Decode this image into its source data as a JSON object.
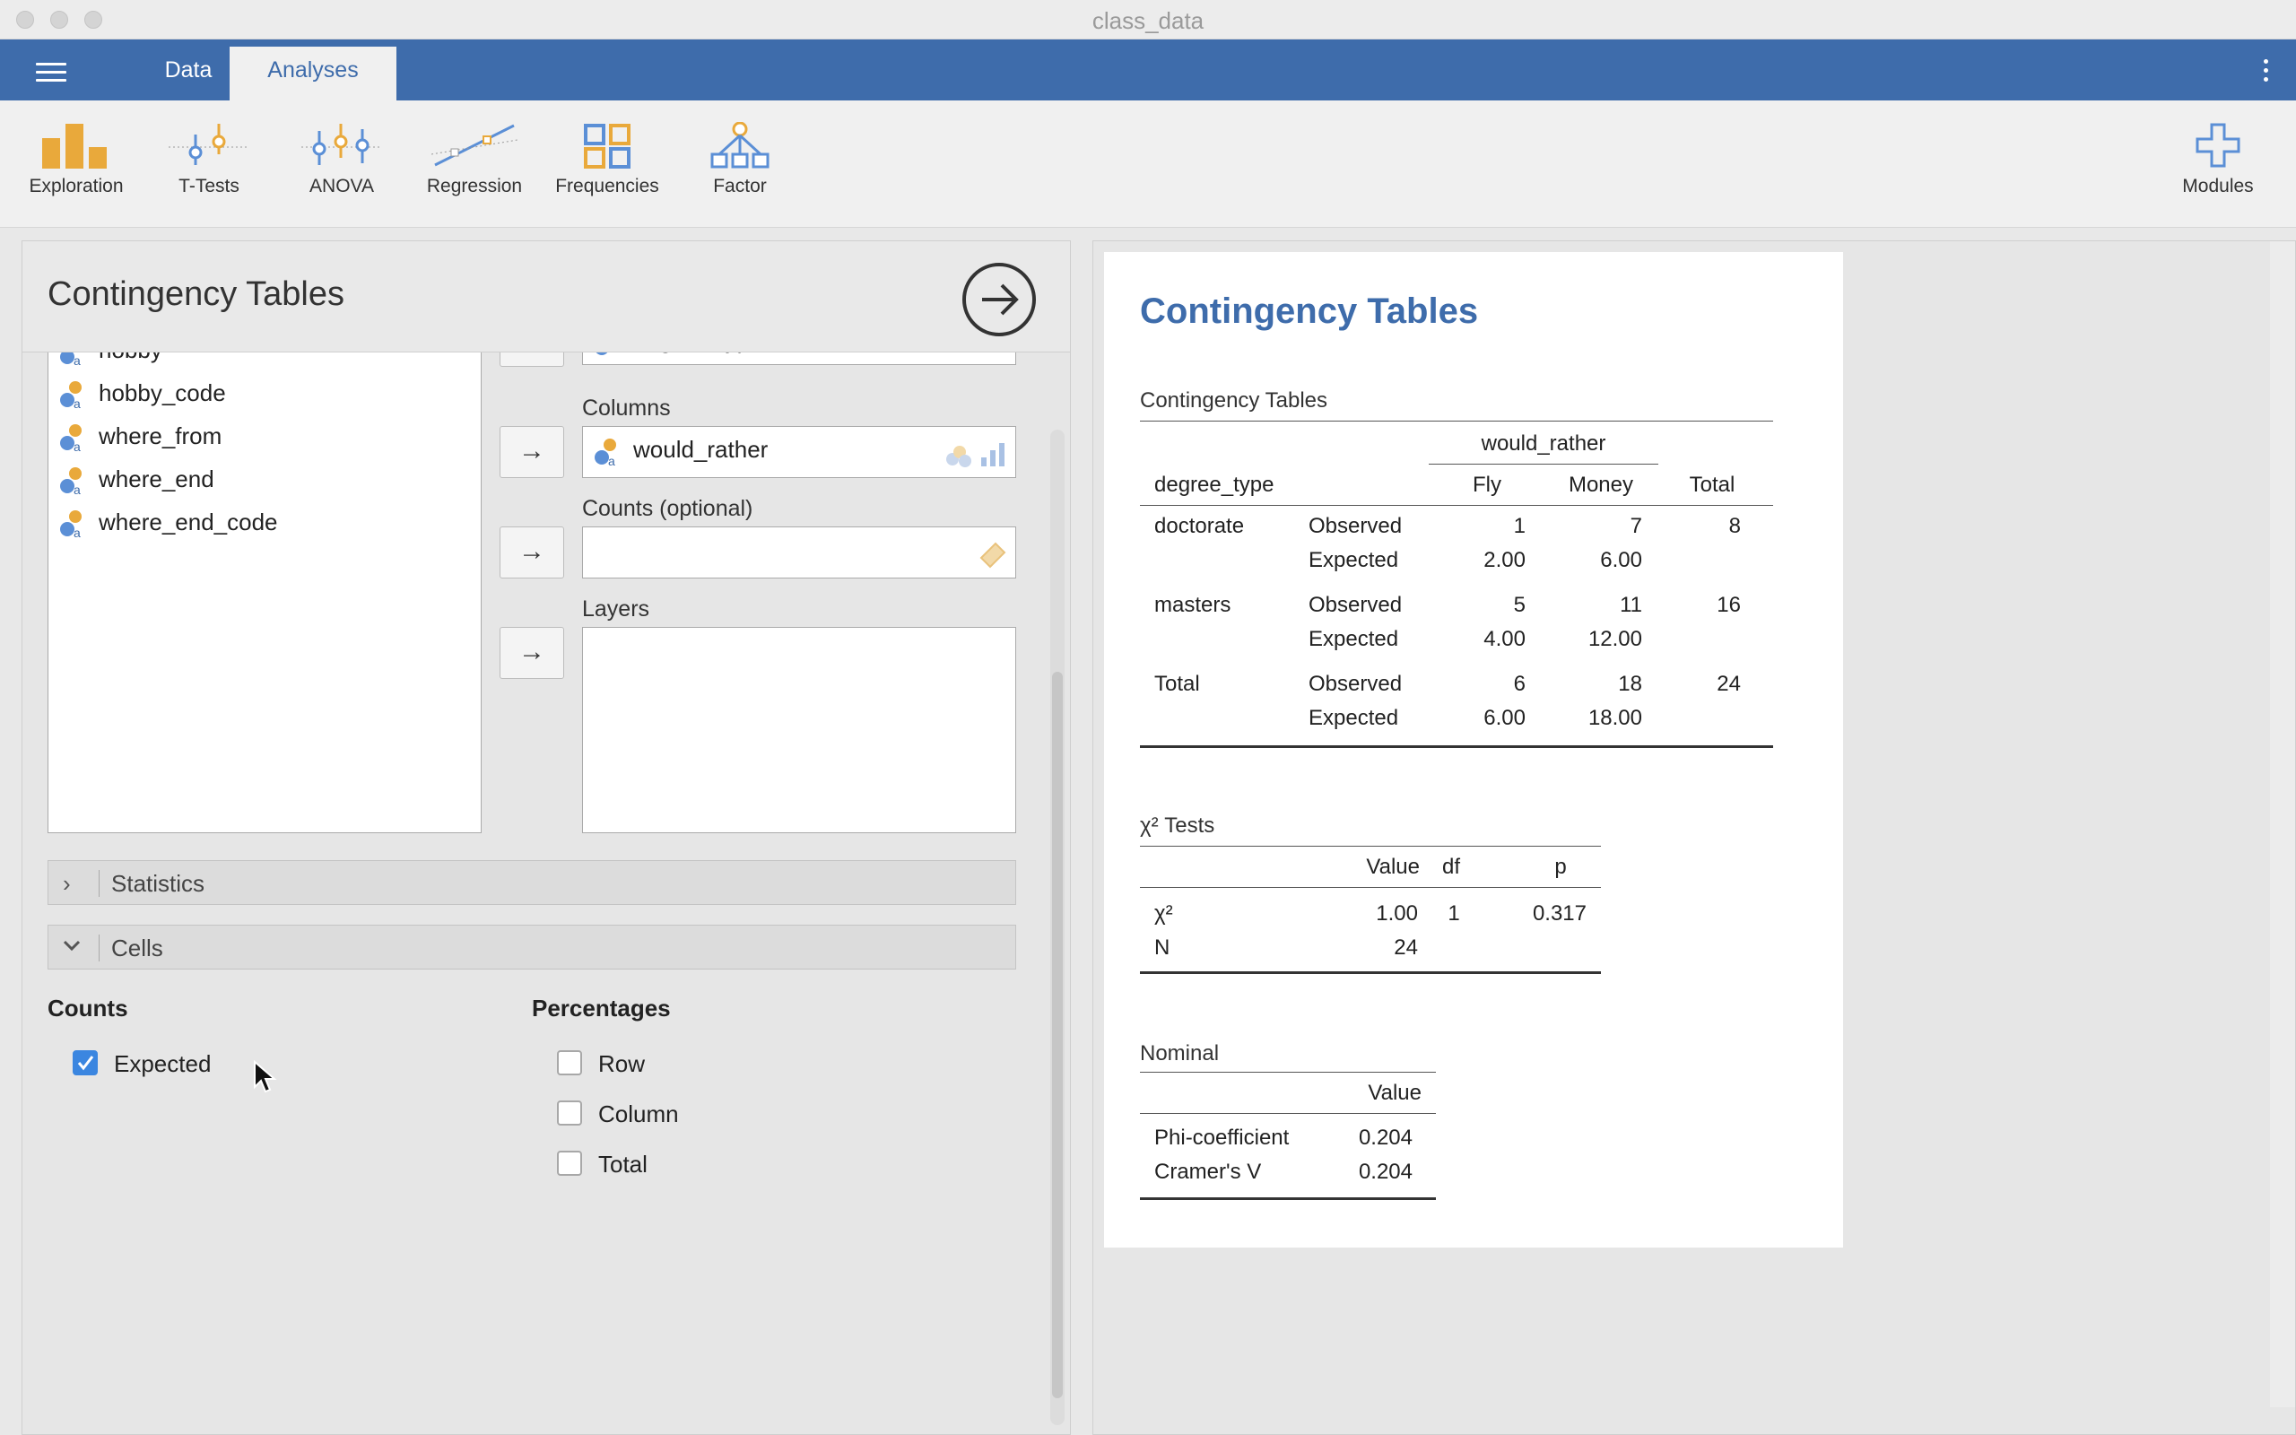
{
  "window": {
    "title": "class_data"
  },
  "nav": {
    "tabs": [
      {
        "label": "Data"
      },
      {
        "label": "Analyses"
      }
    ]
  },
  "ribbon": {
    "items": [
      {
        "label": "Exploration"
      },
      {
        "label": "T-Tests"
      },
      {
        "label": "ANOVA"
      },
      {
        "label": "Regression"
      },
      {
        "label": "Frequencies"
      },
      {
        "label": "Factor"
      }
    ],
    "modules": "Modules"
  },
  "colors": {
    "accent": "#3e6cab",
    "variable_icon": "#e9a93b",
    "checkbox_on": "#3b86e0"
  },
  "options": {
    "title": "Contingency Tables",
    "variables": [
      "hobby",
      "hobby_code",
      "where_from",
      "where_end",
      "where_end_code"
    ],
    "rows_value": "degree_type",
    "arrow": "→",
    "columns": {
      "label": "Columns",
      "value": "would_rather"
    },
    "counts": {
      "label": "Counts (optional)",
      "value": ""
    },
    "layers": {
      "label": "Layers"
    },
    "sections": [
      {
        "label": "Statistics",
        "expanded": false
      },
      {
        "label": "Cells",
        "expanded": true
      }
    ],
    "cells": {
      "counts_title": "Counts",
      "percentages_title": "Percentages",
      "expected": {
        "label": "Expected",
        "checked": true
      },
      "row": {
        "label": "Row",
        "checked": false
      },
      "column": {
        "label": "Column",
        "checked": false
      },
      "total": {
        "label": "Total",
        "checked": false
      }
    }
  },
  "results": {
    "title": "Contingency Tables",
    "contingency": {
      "title": "Contingency Tables",
      "col_var": "would_rather",
      "row_var": "degree_type",
      "col_headers": [
        "Fly",
        "Money",
        "Total"
      ],
      "rows": [
        {
          "name": "doctorate",
          "observed": [
            "1",
            "7",
            "8"
          ],
          "expected": [
            "2.00",
            "6.00"
          ]
        },
        {
          "name": "masters",
          "observed": [
            "5",
            "11",
            "16"
          ],
          "expected": [
            "4.00",
            "12.00"
          ]
        },
        {
          "name": "Total",
          "observed": [
            "6",
            "18",
            "24"
          ],
          "expected": [
            "6.00",
            "18.00"
          ]
        }
      ],
      "observed_label": "Observed",
      "expected_label": "Expected"
    },
    "chisq": {
      "title": "χ² Tests",
      "headers": [
        "Value",
        "df",
        "p"
      ],
      "rows": [
        {
          "name": "χ²",
          "value": "1.00",
          "df": "1",
          "p": "0.317"
        },
        {
          "name": "N",
          "value": "24",
          "df": "",
          "p": ""
        }
      ]
    },
    "nominal": {
      "title": "Nominal",
      "header": "Value",
      "rows": [
        {
          "name": "Phi-coefficient",
          "value": "0.204"
        },
        {
          "name": "Cramer's V",
          "value": "0.204"
        }
      ]
    }
  }
}
